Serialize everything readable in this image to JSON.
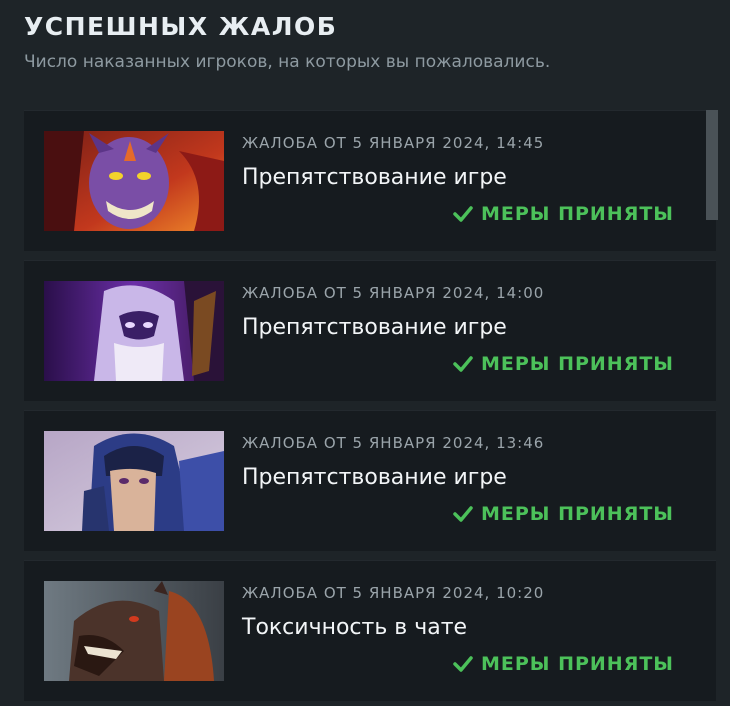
{
  "header": {
    "title": "УСПЕШНЫХ ЖАЛОБ",
    "subtitle": "Число наказанных игроков, на которых вы пожаловались."
  },
  "reports": [
    {
      "date": "ЖАЛОБА ОТ 5 ЯНВАРЯ 2024, 14:45",
      "reason": "Препятствование игре",
      "status": "МЕРЫ ПРИНЯТЫ",
      "hero_icon": "hero-portrait-horned-purple-icon"
    },
    {
      "date": "ЖАЛОБА ОТ 5 ЯНВАРЯ 2024, 14:00",
      "reason": "Препятствование игре",
      "status": "МЕРЫ ПРИНЯТЫ",
      "hero_icon": "hero-portrait-violet-mage-icon"
    },
    {
      "date": "ЖАЛОБА ОТ 5 ЯНВАРЯ 2024, 13:46",
      "reason": "Препятствование игре",
      "status": "МЕРЫ ПРИНЯТЫ",
      "hero_icon": "hero-portrait-helmeted-knight-icon"
    },
    {
      "date": "ЖАЛОБА ОТ 5 ЯНВАРЯ 2024, 10:20",
      "reason": "Токсичность в чате",
      "status": "МЕРЫ ПРИНЯТЫ",
      "hero_icon": "hero-portrait-bear-icon"
    }
  ],
  "colors": {
    "background": "#1e2428",
    "card": "#161b1f",
    "status_green": "#4cc15a",
    "scrollbar_thumb": "#4a5257"
  }
}
